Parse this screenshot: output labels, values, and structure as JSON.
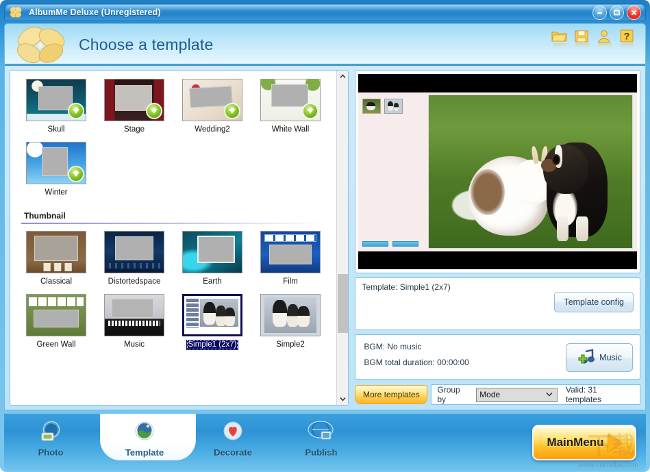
{
  "window": {
    "title": "AlbumMe Deluxe (Unregistered)",
    "logo_icon": "flower-logo-icon",
    "buttons": {
      "minimize": "minimize-icon",
      "maximize": "maximize-icon",
      "close": "close-icon"
    },
    "accent_color": "#2f8fd2",
    "frame_color": "#59b3e6"
  },
  "header": {
    "title": "Choose a template",
    "logo_icon": "flower-logo-icon",
    "tools": [
      {
        "name": "open-folder-icon",
        "glyph": "open"
      },
      {
        "name": "save-icon",
        "glyph": "save"
      },
      {
        "name": "user-account-icon",
        "glyph": "user"
      },
      {
        "name": "help-icon",
        "glyph": "help"
      }
    ]
  },
  "templates": {
    "groups": [
      {
        "name": "",
        "show_header": false,
        "items": [
          {
            "label": "Skull",
            "art": "skull",
            "downloadable": true,
            "selected": false
          },
          {
            "label": "Stage",
            "art": "stage",
            "downloadable": true,
            "selected": false
          },
          {
            "label": "Wedding2",
            "art": "wedding2",
            "downloadable": true,
            "selected": false
          },
          {
            "label": "White Wall",
            "art": "whitewall",
            "downloadable": true,
            "selected": false
          },
          {
            "label": "Winter",
            "art": "winter",
            "downloadable": true,
            "selected": false
          }
        ]
      },
      {
        "name": "Thumbnail",
        "show_header": true,
        "items": [
          {
            "label": "Classical",
            "art": "classical",
            "downloadable": false,
            "selected": false
          },
          {
            "label": "Distortedspace",
            "art": "distorted",
            "downloadable": false,
            "selected": false
          },
          {
            "label": "Earth",
            "art": "earth",
            "downloadable": false,
            "selected": false
          },
          {
            "label": "Film",
            "art": "film",
            "downloadable": false,
            "selected": false
          },
          {
            "label": "Green Wall",
            "art": "greenwall",
            "downloadable": false,
            "selected": false
          },
          {
            "label": "Music",
            "art": "music",
            "downloadable": false,
            "selected": false
          },
          {
            "label": "Simple1 (2x7)",
            "art": "simple1",
            "downloadable": false,
            "selected": true
          },
          {
            "label": "Simple2",
            "art": "simple2",
            "downloadable": false,
            "selected": false
          }
        ]
      }
    ],
    "scrollbar": {
      "up_arrow": "chevron-up-icon",
      "down_arrow": "chevron-down-icon"
    }
  },
  "preview": {
    "photo_alt": "rabbit-and-puppy-photo",
    "thumbnails": [
      "preview-thumb-1",
      "preview-thumb-2"
    ],
    "nav_buttons": [
      "preview-prev-button",
      "preview-next-button"
    ]
  },
  "template_info": {
    "label": "Template: Simple1 (2x7)",
    "config_button": "Template config"
  },
  "bgm": {
    "status": "BGM: No music",
    "duration": "BGM total duration: 00:00:00",
    "music_button": "Music",
    "music_icon": "add-music-icon"
  },
  "bottom_controls": {
    "more_templates": "More templates",
    "group_by_label": "Group by",
    "group_by_value": "Mode",
    "group_by_options": [
      "Mode"
    ],
    "valid_text": "Valid: 31 templates"
  },
  "nav": {
    "tabs": [
      {
        "label": "Photo",
        "icon": "photo-icon",
        "active": false
      },
      {
        "label": "Template",
        "icon": "template-icon",
        "active": true
      },
      {
        "label": "Decorate",
        "icon": "heart-icon",
        "active": false
      },
      {
        "label": "Publish",
        "icon": "globe-icon",
        "active": false
      }
    ],
    "main_menu": {
      "label": "MainMenu",
      "arrow_icon": "play-arrow-icon"
    }
  },
  "watermark": {
    "cjk": "下载",
    "url": "www.xiazaiba.com"
  }
}
